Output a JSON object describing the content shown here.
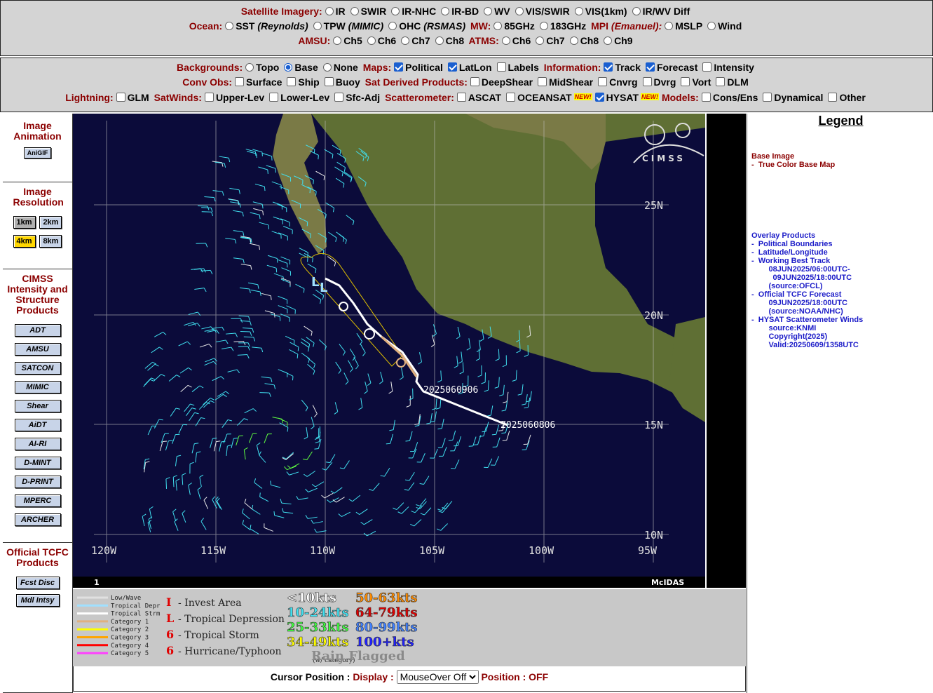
{
  "top_bar": {
    "satellite_label": "Satellite Imagery:",
    "satellite_options": [
      "IR",
      "SWIR",
      "IR-NHC",
      "IR-BD",
      "WV",
      "VIS/SWIR",
      "VIS(1km)",
      "IR/WV Diff"
    ],
    "ocean_label": "Ocean:",
    "ocean_options": [
      {
        "name": "SST",
        "sub": "(Reynolds)"
      },
      {
        "name": "TPW",
        "sub": "(MIMIC)"
      },
      {
        "name": "OHC",
        "sub": "(RSMAS)"
      }
    ],
    "mw_label": "MW:",
    "mw_options": [
      "85GHz",
      "183GHz"
    ],
    "mpi_label": "MPI",
    "mpi_sub": "(Emanuel):",
    "mpi_options": [
      "MSLP",
      "Wind"
    ],
    "amsu_label": "AMSU:",
    "amsu_options": [
      "Ch5",
      "Ch6",
      "Ch7",
      "Ch8"
    ],
    "atms_label": "ATMS:",
    "atms_options": [
      "Ch6",
      "Ch7",
      "Ch8",
      "Ch9"
    ]
  },
  "overlay_bar": {
    "backgrounds_label": "Backgrounds:",
    "backgrounds": [
      {
        "name": "Topo",
        "on": false
      },
      {
        "name": "Base",
        "on": true
      },
      {
        "name": "None",
        "on": false
      }
    ],
    "maps_label": "Maps:",
    "maps": [
      {
        "name": "Political",
        "on": true
      },
      {
        "name": "LatLon",
        "on": true
      },
      {
        "name": "Labels",
        "on": false
      }
    ],
    "info_label": "Information:",
    "info": [
      {
        "name": "Track",
        "on": true
      },
      {
        "name": "Forecast",
        "on": true
      },
      {
        "name": "Intensity",
        "on": false
      }
    ],
    "convobs_label": "Conv Obs:",
    "convobs": [
      "Surface",
      "Ship",
      "Buoy"
    ],
    "satderived_label": "Sat Derived Products:",
    "satderived": [
      "DeepShear",
      "MidShear",
      "Cnvrg",
      "Dvrg",
      "Vort",
      "DLM"
    ],
    "lightning_label": "Lightning:",
    "lightning": [
      "GLM"
    ],
    "satwinds_label": "SatWinds:",
    "satwinds": [
      "Upper-Lev",
      "Lower-Lev",
      "Sfc-Adj"
    ],
    "scatter_label": "Scatterometer:",
    "scatter": [
      {
        "name": "ASCAT",
        "on": false,
        "new": false
      },
      {
        "name": "OCEANSAT",
        "on": false,
        "new": true
      },
      {
        "name": "HYSAT",
        "on": true,
        "new": true
      }
    ],
    "new_badge": "NEW!",
    "models_label": "Models:",
    "models": [
      "Cons/Ens",
      "Dynamical",
      "Other"
    ]
  },
  "left": {
    "animation_title": "Image Animation",
    "anigif": "AniGIF",
    "resolution_title": "Image Resolution",
    "res": [
      "1km",
      "2km",
      "4km",
      "8km"
    ],
    "cimss_title": "CIMSS Intensity and Structure Products",
    "products": [
      "ADT",
      "AMSU",
      "SATCON",
      "MIMIC",
      "Shear",
      "AiDT",
      "AI-RI",
      "D-MINT",
      "D-PRINT",
      "MPERC",
      "ARCHER"
    ],
    "tcfc_title": "Official TCFC Products",
    "tcfc": [
      "Fcst Disc",
      "Mdl Intsy"
    ]
  },
  "map": {
    "lat_labels": [
      "25N",
      "20N",
      "15N",
      "10N"
    ],
    "lon_labels": [
      "120W",
      "115W",
      "110W",
      "105W",
      "100W",
      "95W"
    ],
    "frame_number": "1",
    "mcidas": "McIDAS",
    "logo": "CIMSS",
    "track_label_1": "2025060906",
    "track_label_2": "2025060806"
  },
  "legend_strip": {
    "track_types": [
      "Low/Wave",
      "Tropical Depr",
      "Tropical Strm",
      "Category 1",
      "Category 2",
      "Category 3",
      "Category 4",
      "Category 5"
    ],
    "track_colors": [
      "#e0e0e0",
      "#a0e0ff",
      "#ffffff",
      "#e0b080",
      "#ffff00",
      "#ffa500",
      "#ff0000",
      "#ff40ff"
    ],
    "symbols": [
      "- Invest Area",
      "- Tropical Depression",
      "- Tropical Storm",
      "- Hurricane/Typhoon"
    ],
    "symbol_glyphs": [
      "I",
      "L",
      "6",
      "6"
    ],
    "symbol_note": "(w/ category)",
    "speeds": [
      {
        "t": "<10kts",
        "c": "#ffffff"
      },
      {
        "t": "50-63kts",
        "c": "#ff8c00"
      },
      {
        "t": "10-24kts",
        "c": "#40e0f0"
      },
      {
        "t": "64-79kts",
        "c": "#e00000"
      },
      {
        "t": "25-33kts",
        "c": "#40ff40"
      },
      {
        "t": "80-99kts",
        "c": "#4080ff"
      },
      {
        "t": "34-49kts",
        "c": "#ffff00"
      },
      {
        "t": "100+kts",
        "c": "#2020ff"
      }
    ],
    "rain": "Rain Flagged"
  },
  "cursor": {
    "label": "Cursor Position :",
    "display_label": "Display :",
    "display_value": "MouseOver Off",
    "position_label": "Position :",
    "position_value": "OFF"
  },
  "legend": {
    "title": "Legend",
    "base_image": "Base Image",
    "base_item": "-  True Color Base Map",
    "overlay_title": "Overlay Products",
    "lines": [
      "-  Political Boundaries",
      "-  Latitude/Longitude",
      "-  Working Best Track",
      "        08JUN2025/06:00UTC-",
      "          09JUN2025/18:00UTC",
      "        (source:OFCL)",
      "-  Official TCFC Forecast",
      "        09JUN2025/18:00UTC",
      "        (source:NOAA/NHC)",
      "-  HYSAT Scatterometer Winds",
      "        source:KNMI",
      "        Copyright(2025)",
      "        Valid:20250609/1358UTC"
    ]
  },
  "colors": {
    "label_red": "#8b0000",
    "legend_blue": "#1c1cc8",
    "land": "#6a7a3a",
    "ocean": "#0b0b3a",
    "wind_cyan": "#40e0f0"
  }
}
